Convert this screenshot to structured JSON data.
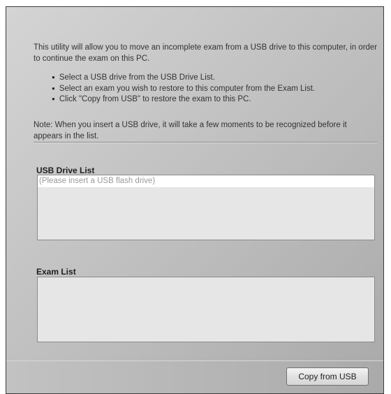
{
  "intro": {
    "text": "This utility will allow you to move an incomplete exam from a USB drive to this computer, in order to continue the exam on this PC."
  },
  "instructions": [
    "Select a USB drive from the USB Drive List.",
    "Select an exam you wish to restore to this computer from the Exam List.",
    "Click \"Copy from USB\" to restore the exam to this PC."
  ],
  "note": {
    "text": "Note:  When you insert a USB drive, it will take a few moments to be recognized before it appears in the list."
  },
  "usb_drive_list": {
    "label": "USB Drive List",
    "items": [
      "(Please insert a USB flash drive)"
    ]
  },
  "exam_list": {
    "label": "Exam List",
    "items": []
  },
  "actions": {
    "copy_label": "Copy from USB"
  }
}
